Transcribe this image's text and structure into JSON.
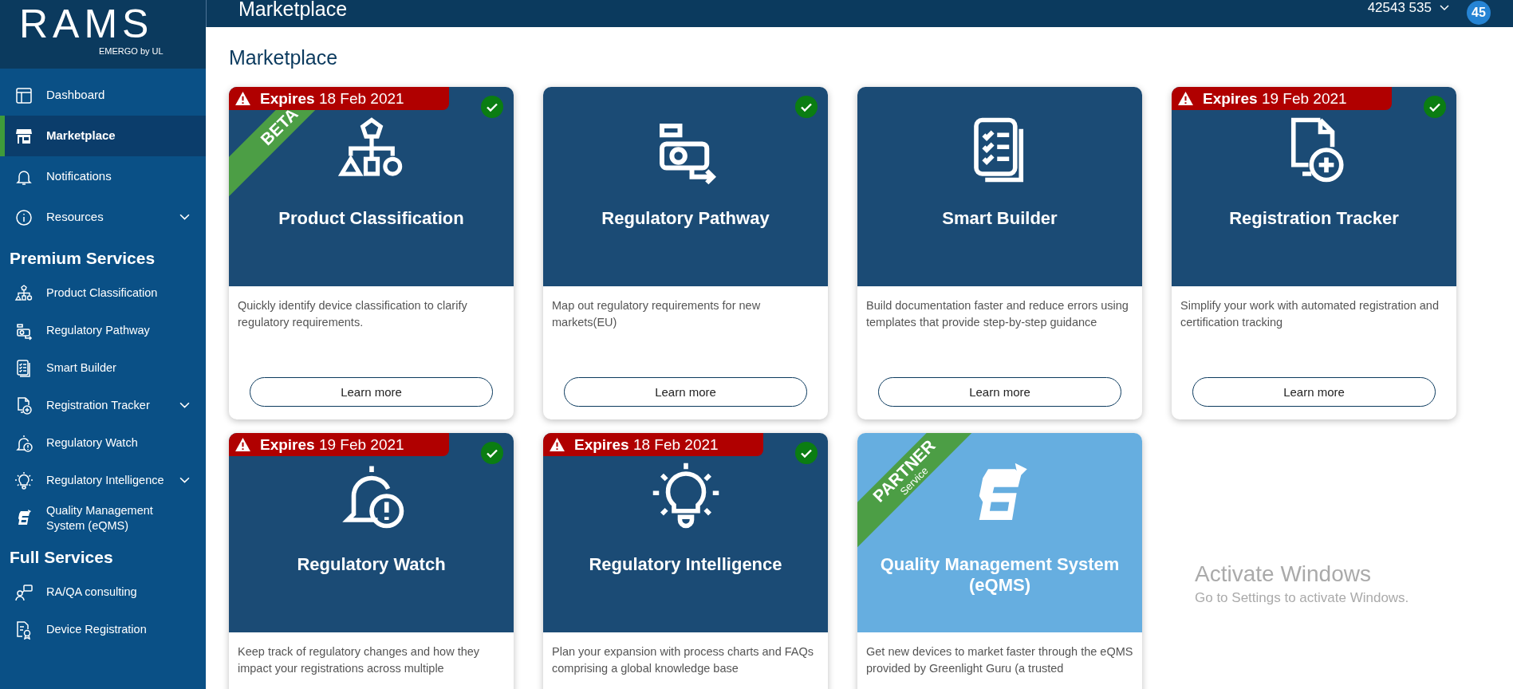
{
  "brand": {
    "name": "RAMS",
    "tagline": "EMERGO by UL"
  },
  "topbar": {
    "title": "Marketplace",
    "account": "42543 535",
    "badge": "45"
  },
  "sidebar": {
    "items": [
      {
        "label": "Dashboard",
        "selected": false,
        "expandable": false
      },
      {
        "label": "Marketplace",
        "selected": true,
        "expandable": false
      },
      {
        "label": "Notifications",
        "selected": false,
        "expandable": false
      },
      {
        "label": "Resources",
        "selected": false,
        "expandable": true
      }
    ],
    "sections": [
      {
        "heading": "Premium Services",
        "items": [
          {
            "label": "Product Classification",
            "selected": false,
            "expandable": false
          },
          {
            "label": "Regulatory Pathway",
            "selected": false,
            "expandable": false
          },
          {
            "label": "Smart Builder",
            "selected": false,
            "expandable": false
          },
          {
            "label": "Registration Tracker",
            "selected": false,
            "expandable": true
          },
          {
            "label": "Regulatory Watch",
            "selected": false,
            "expandable": false
          },
          {
            "label": "Regulatory Intelligence",
            "selected": false,
            "expandable": true
          },
          {
            "label": "Quality Management System (eQMS)",
            "selected": false,
            "expandable": false
          }
        ]
      },
      {
        "heading": "Full Services",
        "items": [
          {
            "label": "RA/QA consulting",
            "selected": false,
            "expandable": false
          },
          {
            "label": "Device Registration",
            "selected": false,
            "expandable": false
          }
        ]
      }
    ]
  },
  "page_title": "Marketplace",
  "cards": [
    {
      "kind": "standard",
      "title": "Product Classification",
      "expires_label": "Expires",
      "expires_date": "18 Feb 2021",
      "subscribed": true,
      "ribbon": {
        "kind": "beta",
        "text": "BETA"
      },
      "description": "Quickly identify device classification to clarify regulatory requirements.",
      "button": "Learn more"
    },
    {
      "kind": "standard",
      "title": "Regulatory Pathway",
      "subscribed": true,
      "description": "Map out regulatory requirements for new markets(EU)",
      "button": "Learn more"
    },
    {
      "kind": "standard",
      "title": "Smart Builder",
      "subscribed": false,
      "description": "Build documentation faster and reduce errors using templates that provide step-by-step guidance",
      "button": "Learn more"
    },
    {
      "kind": "standard",
      "title": "Registration Tracker",
      "expires_label": "Expires",
      "expires_date": "19 Feb 2021",
      "subscribed": true,
      "description": "Simplify your work with automated registration and certification tracking",
      "button": "Learn more"
    },
    {
      "kind": "standard",
      "title": "Regulatory Watch",
      "expires_label": "Expires",
      "expires_date": "19 Feb 2021",
      "subscribed": true,
      "description": "Keep track of regulatory changes and how they impact your registrations across multiple"
    },
    {
      "kind": "standard",
      "title": "Regulatory Intelligence",
      "expires_label": "Expires",
      "expires_date": "18 Feb 2021",
      "subscribed": true,
      "description": "Plan your expansion with process charts and FAQs comprising a global knowledge base"
    },
    {
      "kind": "partner",
      "title": "Quality Management System (eQMS)",
      "subscribed": false,
      "ribbon": {
        "kind": "partner",
        "text": "PARTNER",
        "subtext": "Service"
      },
      "description": "Get new devices to market faster through the eQMS provided by Greenlight Guru (a trusted"
    }
  ],
  "os_notice": {
    "title": "Activate Windows",
    "text": "Go to Settings to activate Windows."
  }
}
